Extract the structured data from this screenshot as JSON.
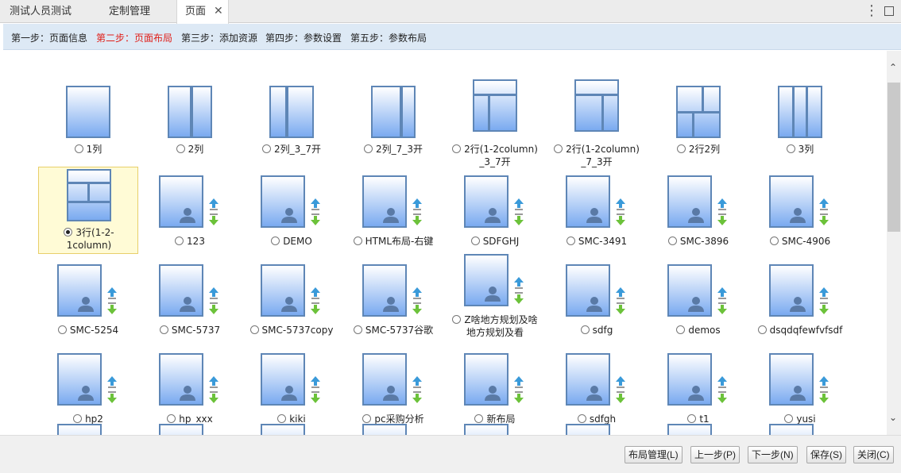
{
  "tabs": [
    {
      "label": "测试人员测试"
    },
    {
      "label": "定制管理"
    },
    {
      "label": "页面",
      "close": "✕"
    }
  ],
  "window_controls": {
    "menu": "⋮"
  },
  "steps": [
    {
      "label": "第一步：页面信息",
      "active": false
    },
    {
      "label": "第二步：页面布局",
      "active": true
    },
    {
      "label": "第三步：添加资源",
      "active": false
    },
    {
      "label": "第四步：参数设置",
      "active": false
    },
    {
      "label": "第五步：参数布局",
      "active": false
    }
  ],
  "layouts_row1": [
    {
      "label": "1列",
      "selected": false
    },
    {
      "label": "2列",
      "selected": false
    },
    {
      "label": "2列_3_7开",
      "selected": false
    },
    {
      "label": "2列_7_3开",
      "selected": false
    },
    {
      "label": "2行(1-2column)\n_3_7开",
      "selected": false
    },
    {
      "label": "2行(1-2column)\n_7_3开",
      "selected": false
    },
    {
      "label": "2行2列",
      "selected": false
    },
    {
      "label": "3列",
      "selected": false
    }
  ],
  "layouts_row2": [
    {
      "label": "3行(1-2-\n1column)",
      "selected": true
    },
    {
      "label": "123"
    },
    {
      "label": "DEMO"
    },
    {
      "label": "HTML布局-右键"
    },
    {
      "label": "SDFGHJ"
    },
    {
      "label": "SMC-3491"
    },
    {
      "label": "SMC-3896"
    },
    {
      "label": "SMC-4906"
    }
  ],
  "layouts_row3": [
    {
      "label": "SMC-5254"
    },
    {
      "label": "SMC-5737"
    },
    {
      "label": "SMC-5737copy"
    },
    {
      "label": "SMC-5737谷歌"
    },
    {
      "label": "Z啥地方规划及啥\n地方规划及看"
    },
    {
      "label": "sdfg"
    },
    {
      "label": "demos"
    },
    {
      "label": "dsqdqfewfvfsdf"
    }
  ],
  "layouts_row4": [
    {
      "label": "hp2"
    },
    {
      "label": "hp_xxx"
    },
    {
      "label": "kiki"
    },
    {
      "label": "pc采购分析"
    },
    {
      "label": "新布局"
    },
    {
      "label": "sdfgh"
    },
    {
      "label": "t1"
    },
    {
      "label": "yusi"
    }
  ],
  "footer_buttons": [
    {
      "label": "布局管理(L)"
    },
    {
      "label": "上一步(P)"
    },
    {
      "label": "下一步(N)"
    },
    {
      "label": "保存(S)"
    },
    {
      "label": "关闭(C)"
    }
  ],
  "colors": {
    "accent": "#e0201a",
    "thumb_border": "#5e86b6",
    "arrow_up": "#3a9ad9",
    "arrow_down": "#6cc23a",
    "selected_bg": "#fffbd6"
  },
  "icons": {
    "user": "user-silhouette-icon",
    "move_up": "move-up-icon",
    "move_down": "move-down-icon"
  }
}
